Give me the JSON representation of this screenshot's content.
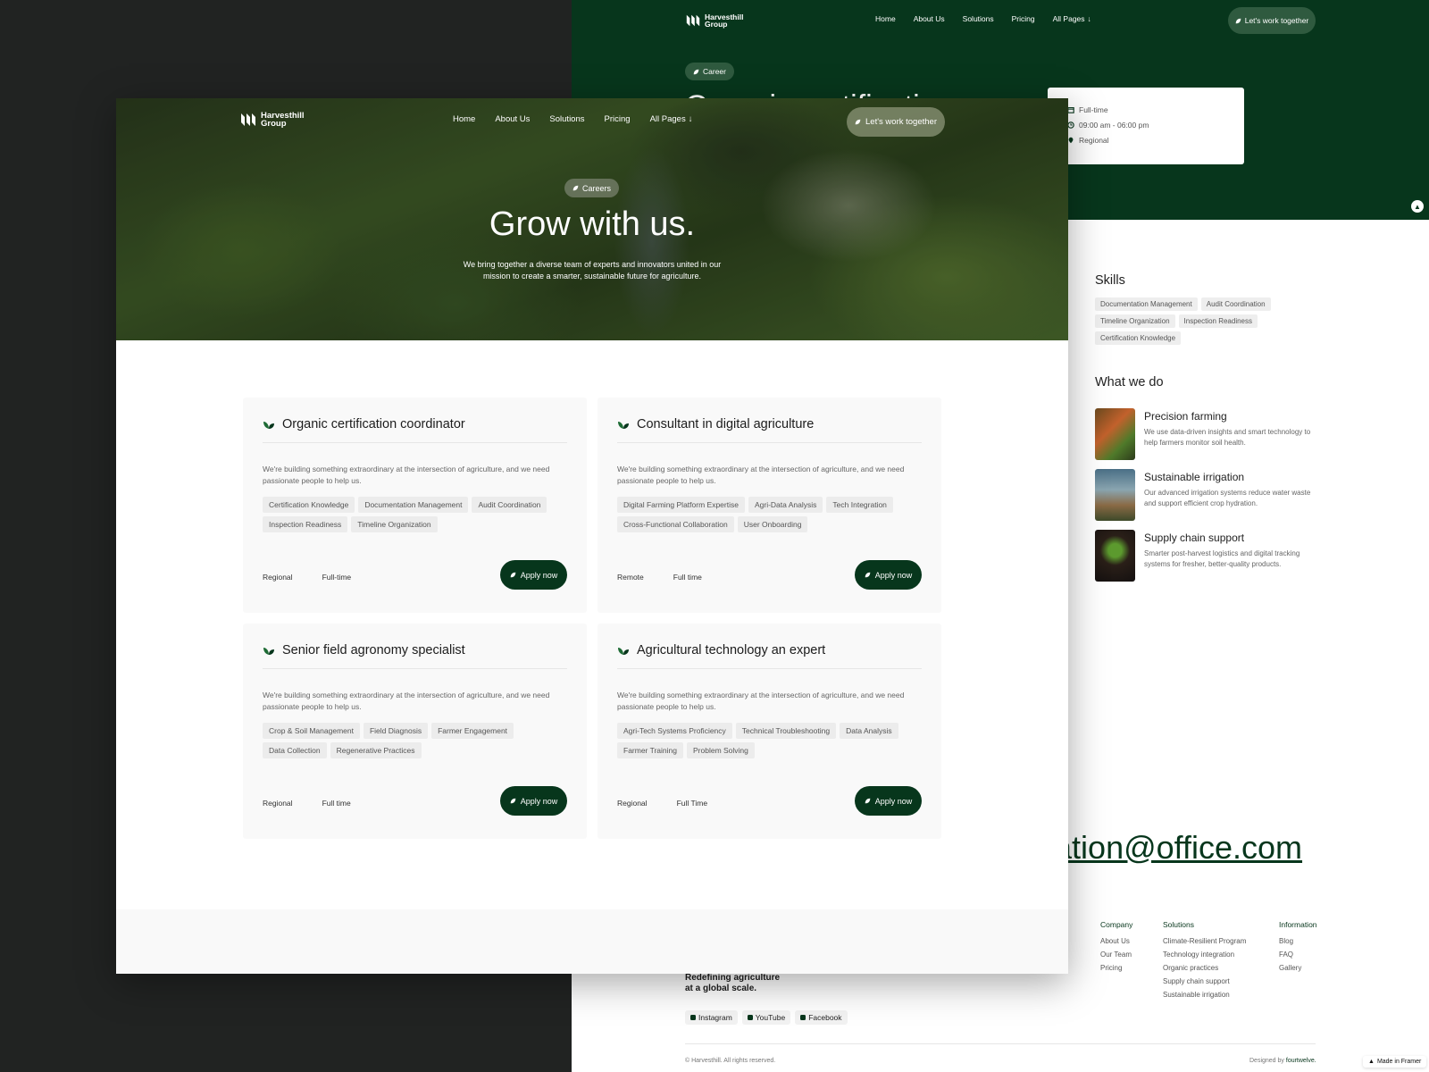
{
  "brand": {
    "name_line1": "Harvesthill",
    "name_line2": "Group",
    "accent": "#07361c"
  },
  "nav": {
    "items": [
      "Home",
      "About Us",
      "Solutions",
      "Pricing",
      "All Pages"
    ],
    "cta": "Let's work together"
  },
  "hero": {
    "pill": "Careers",
    "title": "Grow with us.",
    "subtitle": "We bring together a diverse team of experts and innovators united in our mission to create a smarter, sustainable future for agriculture."
  },
  "jobs": [
    {
      "title": "Organic certification coordinator",
      "description": "We're building something extraordinary at the intersection of agriculture, and we need passionate people to help us.",
      "tags": [
        "Certification Knowledge",
        "Documentation Management",
        "Audit Coordination",
        "Inspection Readiness",
        "Timeline Organization"
      ],
      "location": "Regional",
      "type": "Full-time",
      "apply": "Apply now"
    },
    {
      "title": "Consultant in digital agriculture",
      "description": "We're building something extraordinary at the intersection of agriculture, and we need passionate people to help us.",
      "tags": [
        "Digital Farming Platform Expertise",
        "Agri-Data Analysis",
        "Tech Integration",
        "Cross-Functional Collaboration",
        "User Onboarding"
      ],
      "location": "Remote",
      "type": "Full time",
      "apply": "Apply now"
    },
    {
      "title": "Senior field agronomy specialist",
      "description": "We're building something extraordinary at the intersection of agriculture, and we need passionate people to help us.",
      "tags": [
        "Crop & Soil Management",
        "Field Diagnosis",
        "Farmer Engagement",
        "Data Collection",
        "Regenerative Practices"
      ],
      "location": "Regional",
      "type": "Full time",
      "apply": "Apply now"
    },
    {
      "title": "Agricultural technology an expert",
      "description": "We're building something extraordinary at the intersection of agriculture, and we need passionate people to help us.",
      "tags": [
        "Agri-Tech Systems Proficiency",
        "Technical Troubleshooting",
        "Data Analysis",
        "Farmer Training",
        "Problem Solving"
      ],
      "location": "Regional",
      "type": "Full Time",
      "apply": "Apply now"
    }
  ],
  "detail": {
    "pill": "Career",
    "title_partial": "Organic certificati",
    "info": [
      "Full-time",
      "09:00 am - 06:00 pm",
      "Regional"
    ],
    "skills_heading": "Skills",
    "skills": [
      "Documentation Management",
      "Audit Coordination",
      "Timeline Organization",
      "Inspection Readiness",
      "Certification Knowledge"
    ],
    "wwd_heading": "What we do",
    "wwd": [
      {
        "title": "Precision farming",
        "desc": "We use data-driven insights and smart technology to help farmers monitor soil health."
      },
      {
        "title": "Sustainable irrigation",
        "desc": "Our advanced irrigation systems reduce water waste and support efficient crop hydration."
      },
      {
        "title": "Supply chain support",
        "desc": "Smarter post-harvest logistics and digital tracking systems for fresher, better-quality products."
      }
    ],
    "email_partial": "nation@office.com"
  },
  "footer": {
    "company_heading": "Company",
    "company": [
      "About Us",
      "Our Team",
      "Pricing"
    ],
    "solutions_heading": "Solutions",
    "solutions": [
      "Climate-Resilient Program",
      "Technology integration",
      "Organic practices",
      "Supply chain support",
      "Sustainable irrigation"
    ],
    "information_heading": "Information",
    "information": [
      "Blog",
      "FAQ",
      "Gallery"
    ],
    "tagline_line1": "Redefining agriculture",
    "tagline_line2": "at a global scale.",
    "socials": [
      "Instagram",
      "YouTube",
      "Facebook"
    ],
    "copyright": "© Harvesthill. All rights reserved.",
    "designed_prefix": "Designed by",
    "designed_by": "fourtwelve.",
    "made_in": "Made in Framer"
  }
}
